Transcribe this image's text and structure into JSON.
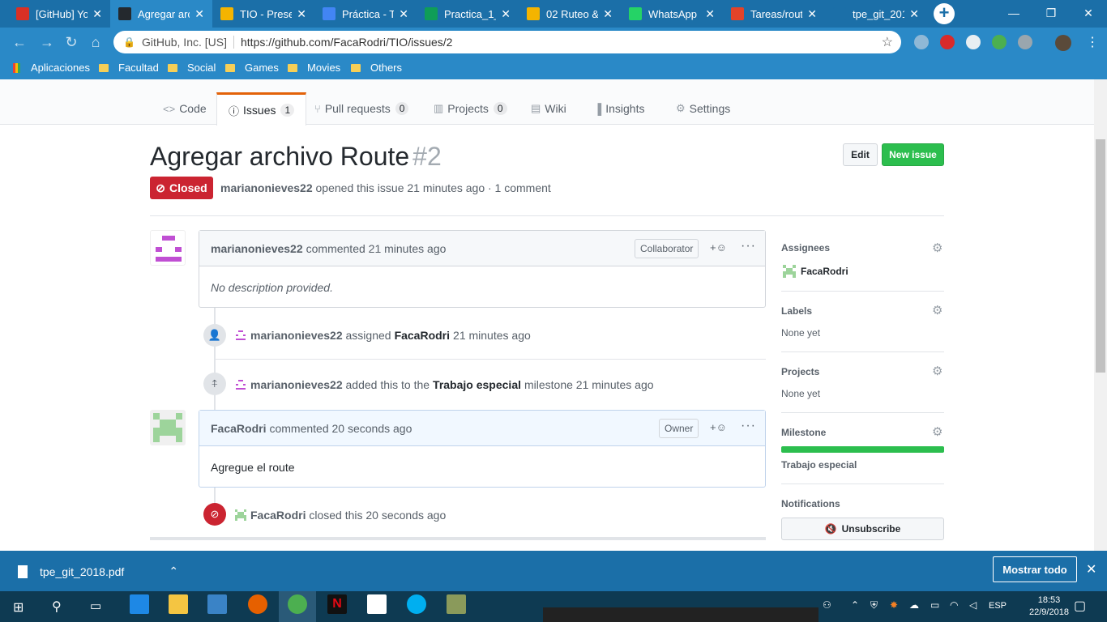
{
  "browser": {
    "tabs": [
      {
        "label": "[GitHub] Yo",
        "icon": "gmail-icon",
        "color": "#d93025"
      },
      {
        "label": "Agregar arc",
        "icon": "github-icon",
        "color": "#24292e",
        "active": true
      },
      {
        "label": "TIO - Prese",
        "icon": "slides-icon",
        "color": "#f4b400"
      },
      {
        "label": "Práctica - T",
        "icon": "forms-icon",
        "color": "#4285f4"
      },
      {
        "label": "Practica_1_",
        "icon": "drive-icon",
        "color": "#0f9d58"
      },
      {
        "label": "02 Ruteo &",
        "icon": "slides-icon",
        "color": "#f4b400"
      },
      {
        "label": "WhatsApp",
        "icon": "whatsapp-icon",
        "color": "#25d366"
      },
      {
        "label": "Tareas/rout",
        "icon": "gitlab-icon",
        "color": "#e24329"
      },
      {
        "label": "tpe_git_201",
        "icon": "file-icon",
        "color": "#1b6fa8"
      }
    ],
    "site_label": "GitHub, Inc. [US]",
    "url": "https://github.com/FacaRodri/TIO/issues/2",
    "bookmarks": [
      "Aplicaciones",
      "Facultad",
      "Social",
      "Games",
      "Movies",
      "Others"
    ]
  },
  "repo_nav": {
    "tabs": [
      {
        "label": "Code",
        "icon": "code-icon"
      },
      {
        "label": "Issues",
        "count": "1",
        "icon": "issue-icon",
        "selected": true
      },
      {
        "label": "Pull requests",
        "count": "0",
        "icon": "pr-icon"
      },
      {
        "label": "Projects",
        "count": "0",
        "icon": "project-icon"
      },
      {
        "label": "Wiki",
        "icon": "wiki-icon"
      },
      {
        "label": "Insights",
        "icon": "graph-icon"
      },
      {
        "label": "Settings",
        "icon": "gear-icon"
      }
    ]
  },
  "issue": {
    "title": "Agregar archivo Route",
    "number": "#2",
    "status": "Closed",
    "edit_label": "Edit",
    "new_issue_label": "New issue",
    "author": "marianonieves22",
    "meta_text": "opened this issue 21 minutes ago · 1 comment"
  },
  "timeline": {
    "comment1": {
      "author": "marianonieves22",
      "time": "commented 21 minutes ago",
      "role": "Collaborator",
      "body": "No description provided."
    },
    "event_assign": {
      "actor": "marianonieves22",
      "verb": "assigned",
      "target": "FacaRodri",
      "time": "21 minutes ago"
    },
    "event_milestone": {
      "actor": "marianonieves22",
      "verb": "added this to the",
      "target": "Trabajo especial",
      "suffix": "milestone 21 minutes ago"
    },
    "comment2": {
      "author": "FacaRodri",
      "time": "commented 20 seconds ago",
      "role": "Owner",
      "body": "Agregue el route"
    },
    "event_closed": {
      "actor": "FacaRodri",
      "text": "closed this 20 seconds ago"
    }
  },
  "sidebar": {
    "assignees_label": "Assignees",
    "assignee": "FacaRodri",
    "labels_label": "Labels",
    "labels_value": "None yet",
    "projects_label": "Projects",
    "projects_value": "None yet",
    "milestone_label": "Milestone",
    "milestone_progress": 1.0,
    "milestone_value": "Trabajo especial",
    "notifications_label": "Notifications",
    "unsubscribe_label": "Unsubscribe"
  },
  "downloads": {
    "file": "tpe_git_2018.pdf",
    "show_all": "Mostrar todo"
  },
  "taskbar": {
    "lang": "ESP",
    "time": "18:53",
    "date": "22/9/2018"
  }
}
